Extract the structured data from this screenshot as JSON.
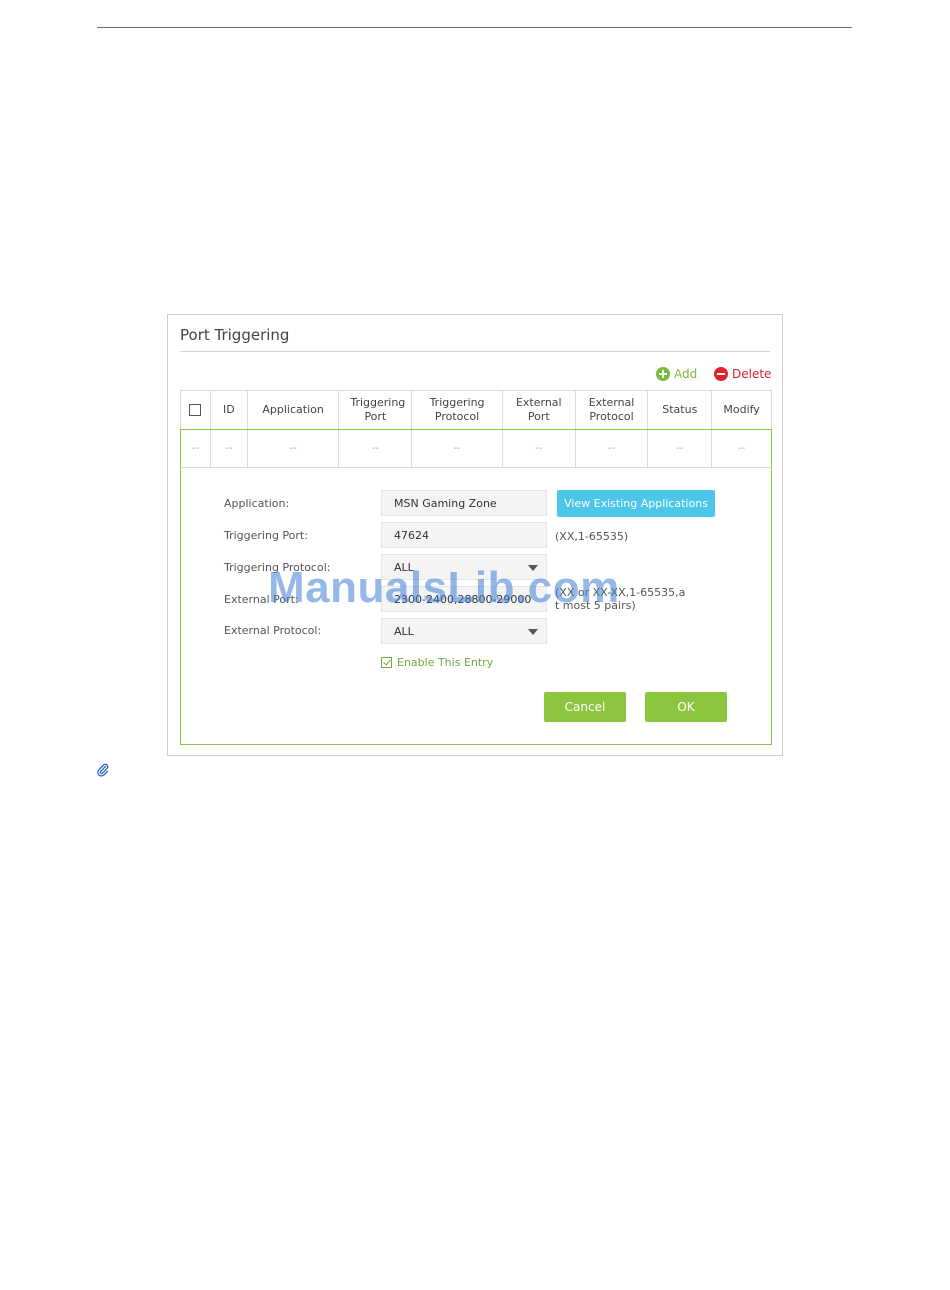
{
  "panel": {
    "title": "Port Triggering",
    "actions": {
      "add": "Add",
      "delete": "Delete"
    }
  },
  "table": {
    "headers": {
      "id": "ID",
      "application": "Application",
      "triggering_port": "Triggering Port",
      "triggering_protocol": "Triggering Protocol",
      "external_port": "External Port",
      "external_protocol": "External Protocol",
      "status": "Status",
      "modify": "Modify"
    },
    "empty_row": [
      "--",
      "--",
      "--",
      "--",
      "--",
      "--",
      "--",
      "--",
      "--"
    ]
  },
  "form": {
    "application": {
      "label": "Application:",
      "value": "MSN Gaming Zone",
      "button": "View Existing Applications"
    },
    "triggering_port": {
      "label": "Triggering Port:",
      "value": "47624",
      "hint": "(XX,1-65535)"
    },
    "triggering_protocol": {
      "label": "Triggering Protocol:",
      "value": "ALL"
    },
    "external_port": {
      "label": "External Port:",
      "value": "2300-2400,28800-29000",
      "hint_line1": "(XX or XX-XX,1-65535,a",
      "hint_line2": "t most 5 pairs)"
    },
    "external_protocol": {
      "label": "External Protocol:",
      "value": "ALL"
    },
    "enable_entry": "Enable This Entry",
    "cancel": "Cancel",
    "ok": "OK"
  },
  "watermark": "ManualsLib.com",
  "colors": {
    "green": "#8cc63f",
    "blue": "#4cc7ea",
    "red": "#e2232e"
  }
}
